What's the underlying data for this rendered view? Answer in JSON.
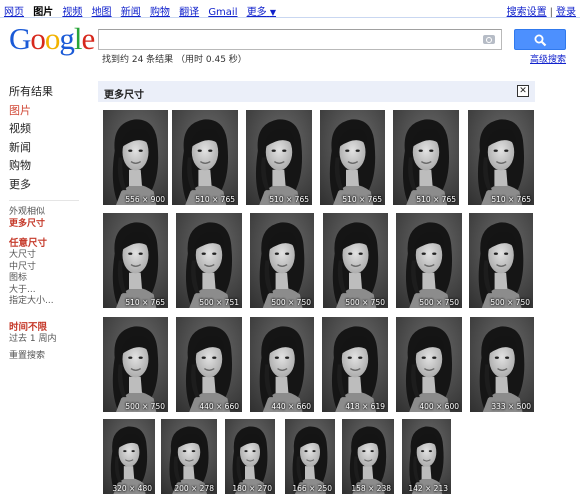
{
  "topbar": {
    "left_links": [
      "网页",
      "图片",
      "视频",
      "地图",
      "新闻",
      "购物",
      "翻译",
      "Gmail",
      "更多"
    ],
    "active_link": "图片",
    "more_arrow": "▼",
    "right_links": [
      "搜索设置",
      "登录"
    ],
    "separator": "|"
  },
  "logo": {
    "text": "Google"
  },
  "search": {
    "value": "",
    "placeholder": ""
  },
  "stats": "找到约 24 条结果 （用时 0.45 秒）",
  "advanced_search": "高级搜索",
  "sidebar": {
    "nav": [
      "所有结果",
      "图片",
      "视频",
      "新闻",
      "购物",
      "更多"
    ],
    "active_nav": "图片",
    "similar": "外观相似",
    "more_sizes_selected": "更多尺寸",
    "size_heading": "任意尺寸",
    "sizes": [
      "大尺寸",
      "中尺寸",
      "图标",
      "大于...",
      "指定大小..."
    ],
    "time_heading": "时间不限",
    "times": [
      "过去 1 周内"
    ],
    "reset": "重置搜索"
  },
  "panel": {
    "title": "更多尺寸",
    "close_icon": "close-icon"
  },
  "colors": {
    "accent_blue": "#4d90fe",
    "panel_bg": "#ebeff9",
    "link": "#1122cc",
    "selected_red": "#c53929"
  },
  "images": [
    "556 × 900",
    "510 × 765",
    "510 × 765",
    "510 × 765",
    "510 × 765",
    "510 × 765",
    "510 × 765",
    "500 × 751",
    "500 × 750",
    "500 × 750",
    "500 × 750",
    "500 × 750",
    "500 × 750",
    "440 × 660",
    "440 × 660",
    "418 × 619",
    "400 × 600",
    "333 × 500",
    "320 × 480",
    "200 × 278",
    "180 × 270",
    "166 × 250",
    "158 × 238",
    "142 × 213"
  ]
}
